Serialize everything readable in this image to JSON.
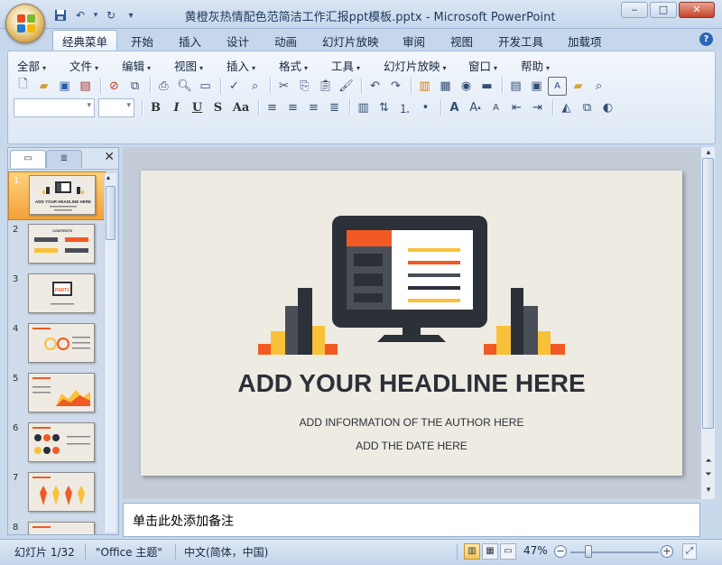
{
  "window": {
    "title": "黄橙灰热情配色范简洁工作汇报ppt模板.pptx - Microsoft PowerPoint",
    "controls": [
      "minimize",
      "maximize",
      "close"
    ]
  },
  "quick_access": [
    "save-icon",
    "undo-icon",
    "redo-icon",
    "customize-icon"
  ],
  "ribbon_tabs": [
    "经典菜单",
    "开始",
    "插入",
    "设计",
    "动画",
    "幻灯片放映",
    "审阅",
    "视图",
    "开发工具",
    "加载项"
  ],
  "active_tab": "经典菜单",
  "classic_menu": [
    "全部",
    "文件",
    "编辑",
    "视图",
    "插入",
    "格式",
    "工具",
    "幻灯片放映",
    "窗口",
    "帮助"
  ],
  "toolbar_format": {
    "bold": "B",
    "italic": "I",
    "underline": "U",
    "shadow": "S",
    "change_case": "Aa"
  },
  "slides_panel": {
    "slide_numbers": [
      "1",
      "2",
      "3",
      "4",
      "5",
      "6",
      "7",
      "8"
    ],
    "selected": 1,
    "slide1_title": "ADD YOUR HEADLINE HERE",
    "slide2_label": "CONTENTS",
    "slide3_label": "PART1"
  },
  "slide": {
    "headline": "ADD YOUR HEADLINE HERE",
    "author": "ADD INFORMATION OF THE  AUTHOR HERE",
    "date": "ADD THE  DATE HERE",
    "colors": {
      "background": "#eeebe2",
      "orange": "#f15a22",
      "yellow": "#f9c13a",
      "dark": "#2b3039",
      "gray": "#4a4f57"
    }
  },
  "notes": {
    "placeholder": "单击此处添加备注"
  },
  "status": {
    "slide_counter": "幻灯片 1/32",
    "theme": "\"Office 主题\"",
    "language": "中文(简体，中国)",
    "zoom": "47%"
  }
}
